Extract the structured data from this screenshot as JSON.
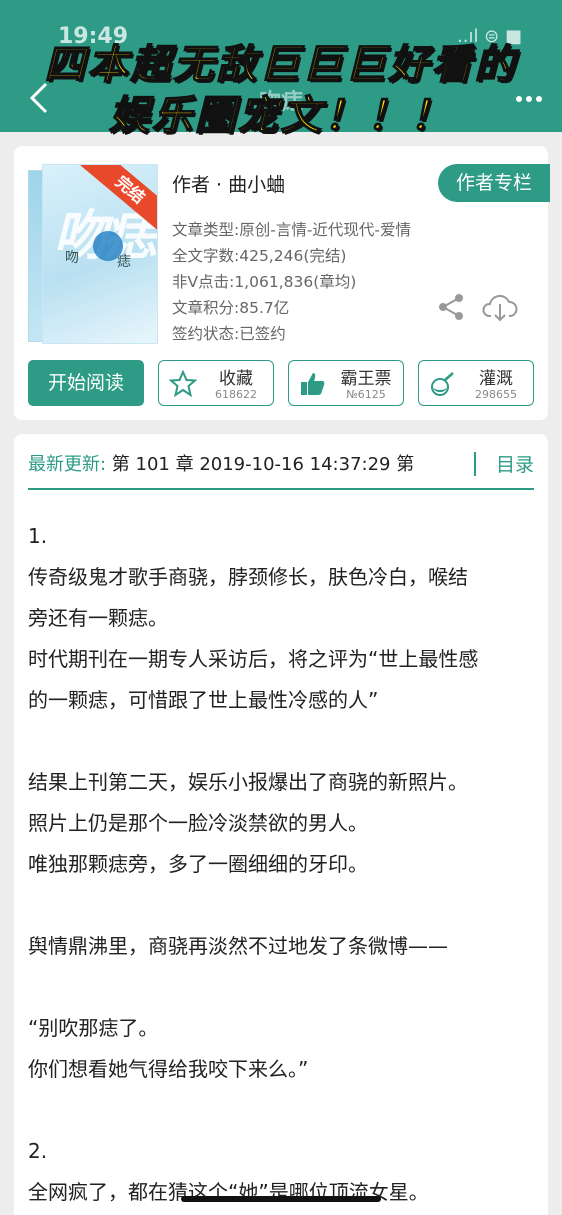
{
  "status_bar": {
    "time": "19:49",
    "signal": "..ıl ⊜ ■"
  },
  "nav": {
    "title": "吻痣"
  },
  "overlay": {
    "line1": "四本超无敌巨巨巨好看的",
    "line2": "娱乐圈宠文！！！"
  },
  "book": {
    "cover_title": "吻痣",
    "cover_small_left": "吻",
    "cover_small_right": "痣",
    "cover_ribbon": "完结",
    "author_line": "作者 · 曲小蛐",
    "author_column_label": "作者专栏",
    "meta": {
      "type": "文章类型:原创-言情-近代现代-爱情",
      "word_count": "全文字数:425,246(完结)",
      "clicks": "非Ⅴ点击:1,061,836(章均)",
      "score": "文章积分:85.7亿",
      "contract": "签约状态:已签约"
    },
    "read_button": "开始阅读",
    "actions": [
      {
        "label": "收藏",
        "count": "618622"
      },
      {
        "label": "霸王票",
        "count": "№6125"
      },
      {
        "label": "灌溉",
        "count": "298655"
      }
    ]
  },
  "chapter": {
    "update_label": "最新更新:",
    "update_text": " 第 101 章 2019-10-16 14:37:29  第",
    "toc_label": "目录",
    "lines": [
      "1.",
      "传奇级鬼才歌手商骁，脖颈修长，肤色冷白，喉结",
      "旁还有一颗痣。",
      "时代期刊在一期专人采访后，将之评为“世上最性感",
      "的一颗痣，可惜跟了世上最性冷感的人”",
      "",
      "结果上刊第二天，娱乐小报爆出了商骁的新照片。",
      "照片上仍是那个一脸冷淡禁欲的男人。",
      "唯独那颗痣旁，多了一圈细细的牙印。",
      "",
      "舆情鼎沸里，商骁再淡然不过地发了条微博——",
      "",
      "“别吹那痣了。",
      "你们想看她气得给我咬下来么。”",
      "",
      "2.",
      "全网疯了，都在猜这个“她”是哪位顶流女星。"
    ]
  },
  "colors": {
    "accent": "#2d9b86",
    "overlay_text": "#ffe400",
    "ribbon": "#e8492a"
  }
}
